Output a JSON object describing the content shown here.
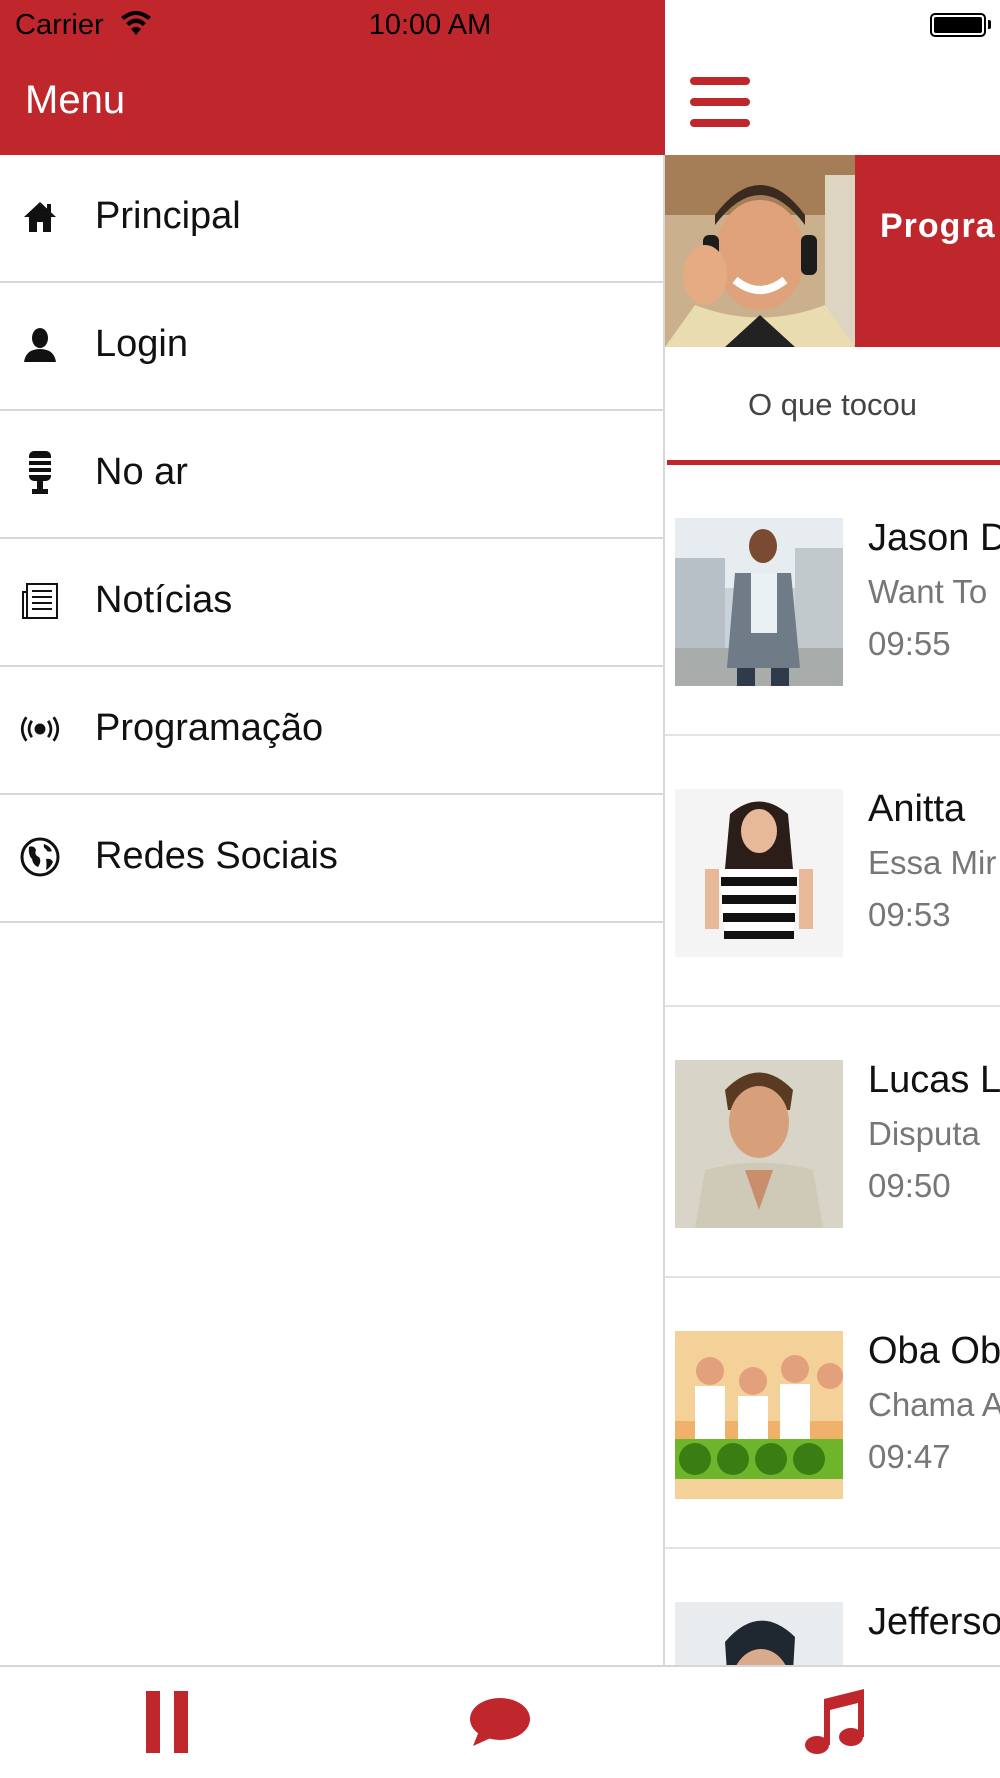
{
  "status_bar": {
    "carrier": "Carrier",
    "time": "10:00 AM"
  },
  "drawer": {
    "title": "Menu",
    "items": [
      {
        "label": "Principal",
        "icon": "home-icon"
      },
      {
        "label": "Login",
        "icon": "user-icon"
      },
      {
        "label": "No ar",
        "icon": "microphone-icon"
      },
      {
        "label": "Notícias",
        "icon": "newspaper-icon"
      },
      {
        "label": "Programação",
        "icon": "broadcast-icon"
      },
      {
        "label": "Redes Sociais",
        "icon": "globe-icon"
      }
    ]
  },
  "main": {
    "banner_title": "Progra",
    "tab_label": "O que tocou",
    "tracks": [
      {
        "artist": "Jason D",
        "song": "Want To",
        "time": "09:55"
      },
      {
        "artist": "Anitta",
        "song": "Essa Mir",
        "time": "09:53"
      },
      {
        "artist": "Lucas L",
        "song": "Disputa",
        "time": "09:50"
      },
      {
        "artist": "Oba Oba",
        "song": "Chama A",
        "time": "09:47"
      },
      {
        "artist": "Jefferso",
        "song": "",
        "time": ""
      }
    ]
  },
  "bottom_bar": {
    "buttons": [
      "pause-icon",
      "chat-icon",
      "music-note-icon"
    ]
  },
  "colors": {
    "accent": "#c0272d",
    "divider": "#d9d9d9"
  }
}
